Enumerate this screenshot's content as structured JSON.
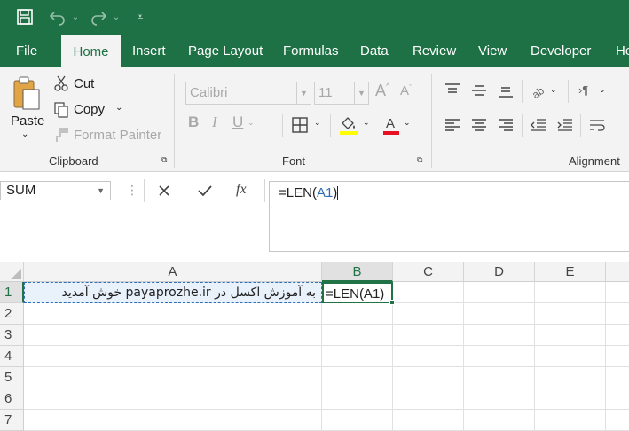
{
  "tabs": [
    "File",
    "Home",
    "Insert",
    "Page Layout",
    "Formulas",
    "Data",
    "Review",
    "View",
    "Developer",
    "He"
  ],
  "active_tab": "Home",
  "clipboard": {
    "paste": "Paste",
    "cut": "Cut",
    "copy": "Copy",
    "format_painter": "Format Painter",
    "group_label": "Clipboard"
  },
  "font": {
    "name": "Calibri",
    "size": "11",
    "group_label": "Font"
  },
  "alignment": {
    "group_label": "Alignment"
  },
  "formula_bar": {
    "name_box": "SUM",
    "formula_prefix": "=LEN(",
    "formula_ref": "A1",
    "formula_suffix": ")"
  },
  "columns": [
    "A",
    "B",
    "C",
    "D",
    "E"
  ],
  "rows": [
    "1",
    "2",
    "3",
    "4",
    "5",
    "6",
    "7"
  ],
  "cells": {
    "A1": "به آموزش اکسل در payaprozhe.ir خوش آمدید",
    "B1": "=LEN(A1)"
  },
  "colors": {
    "brand": "#1e7145",
    "selection": "#217346",
    "ref_blue": "#2f6db5"
  }
}
